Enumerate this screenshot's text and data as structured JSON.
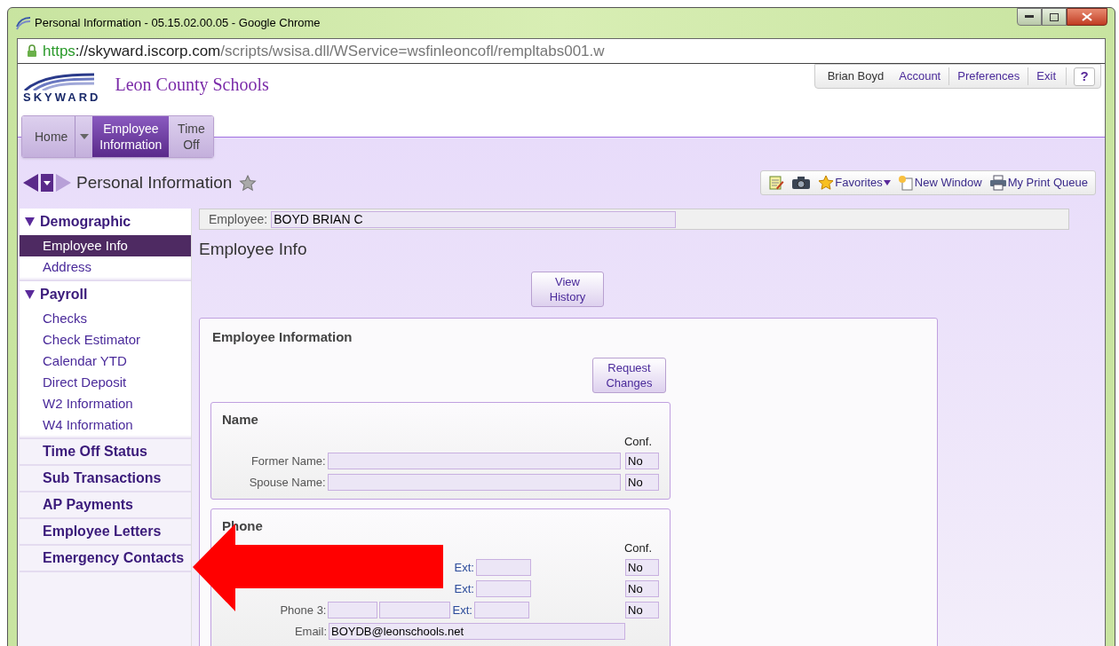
{
  "window": {
    "title": "Personal Information - 05.15.02.00.05 - Google Chrome"
  },
  "address_bar": {
    "scheme": "https",
    "host": "://skyward.iscorp.com",
    "path": "/scripts/wsisa.dll/WService=wsfinleoncofl/rempltabs001.w"
  },
  "site": {
    "logo_text": "SKYWARD",
    "district": "Leon County Schools"
  },
  "user_menu": {
    "user": "Brian Boyd",
    "links": [
      "Account",
      "Preferences",
      "Exit"
    ],
    "help": "?"
  },
  "nav_tabs": [
    {
      "label": "Home",
      "selected": false,
      "dropdown": true
    },
    {
      "label": "Employee Information",
      "selected": true,
      "dropdown": false
    },
    {
      "label": "Time Off",
      "selected": false,
      "dropdown": false
    }
  ],
  "page_title": "Personal Information",
  "toolbar": [
    {
      "kind": "notes"
    },
    {
      "kind": "camera"
    },
    {
      "kind": "favorites",
      "label": "Favorites"
    },
    {
      "kind": "new_window",
      "label": "New Window"
    },
    {
      "kind": "print",
      "label": "My Print Queue"
    }
  ],
  "sidebar": [
    {
      "kind": "group",
      "label": "Demographic",
      "expanded": true,
      "children": [
        {
          "label": "Employee Info",
          "selected": true
        },
        {
          "label": "Address",
          "selected": false
        }
      ]
    },
    {
      "kind": "group",
      "label": "Payroll",
      "expanded": true,
      "children": [
        {
          "label": "Checks",
          "selected": false
        },
        {
          "label": "Check Estimator",
          "selected": false
        },
        {
          "label": "Calendar YTD",
          "selected": false
        },
        {
          "label": "Direct Deposit",
          "selected": false
        },
        {
          "label": "W2 Information",
          "selected": false
        },
        {
          "label": "W4 Information",
          "selected": false
        }
      ]
    },
    {
      "kind": "link",
      "label": "Time Off Status"
    },
    {
      "kind": "link",
      "label": "Sub Transactions"
    },
    {
      "kind": "link",
      "label": "AP Payments"
    },
    {
      "kind": "link",
      "label": "Employee Letters"
    },
    {
      "kind": "link",
      "label": "Emergency Contacts"
    }
  ],
  "employee": {
    "label": "Employee:",
    "value": "BOYD BRIAN C"
  },
  "heading": "Employee Info",
  "view_history_button": "View History",
  "panel": {
    "title": "Employee Information",
    "button": "Request Changes",
    "sections": [
      {
        "title": "Name",
        "conf_header": "Conf.",
        "rows": [
          {
            "kind": "text",
            "label": "Former Name:",
            "conf": "No"
          },
          {
            "kind": "text",
            "label": "Spouse Name:",
            "conf": "No"
          }
        ]
      },
      {
        "title": "Phone",
        "conf_header": "Conf.",
        "rows": [
          {
            "kind": "phone",
            "ext_label": "Ext:",
            "conf": "No"
          },
          {
            "kind": "phone",
            "ext_label": "Ext:",
            "conf": "No"
          },
          {
            "kind": "phone",
            "label": "Phone 3:",
            "ext_label": "Ext:",
            "conf": "No"
          },
          {
            "kind": "text",
            "label": "Email:",
            "value": "BOYDB@leonschools.net"
          }
        ]
      }
    ]
  }
}
